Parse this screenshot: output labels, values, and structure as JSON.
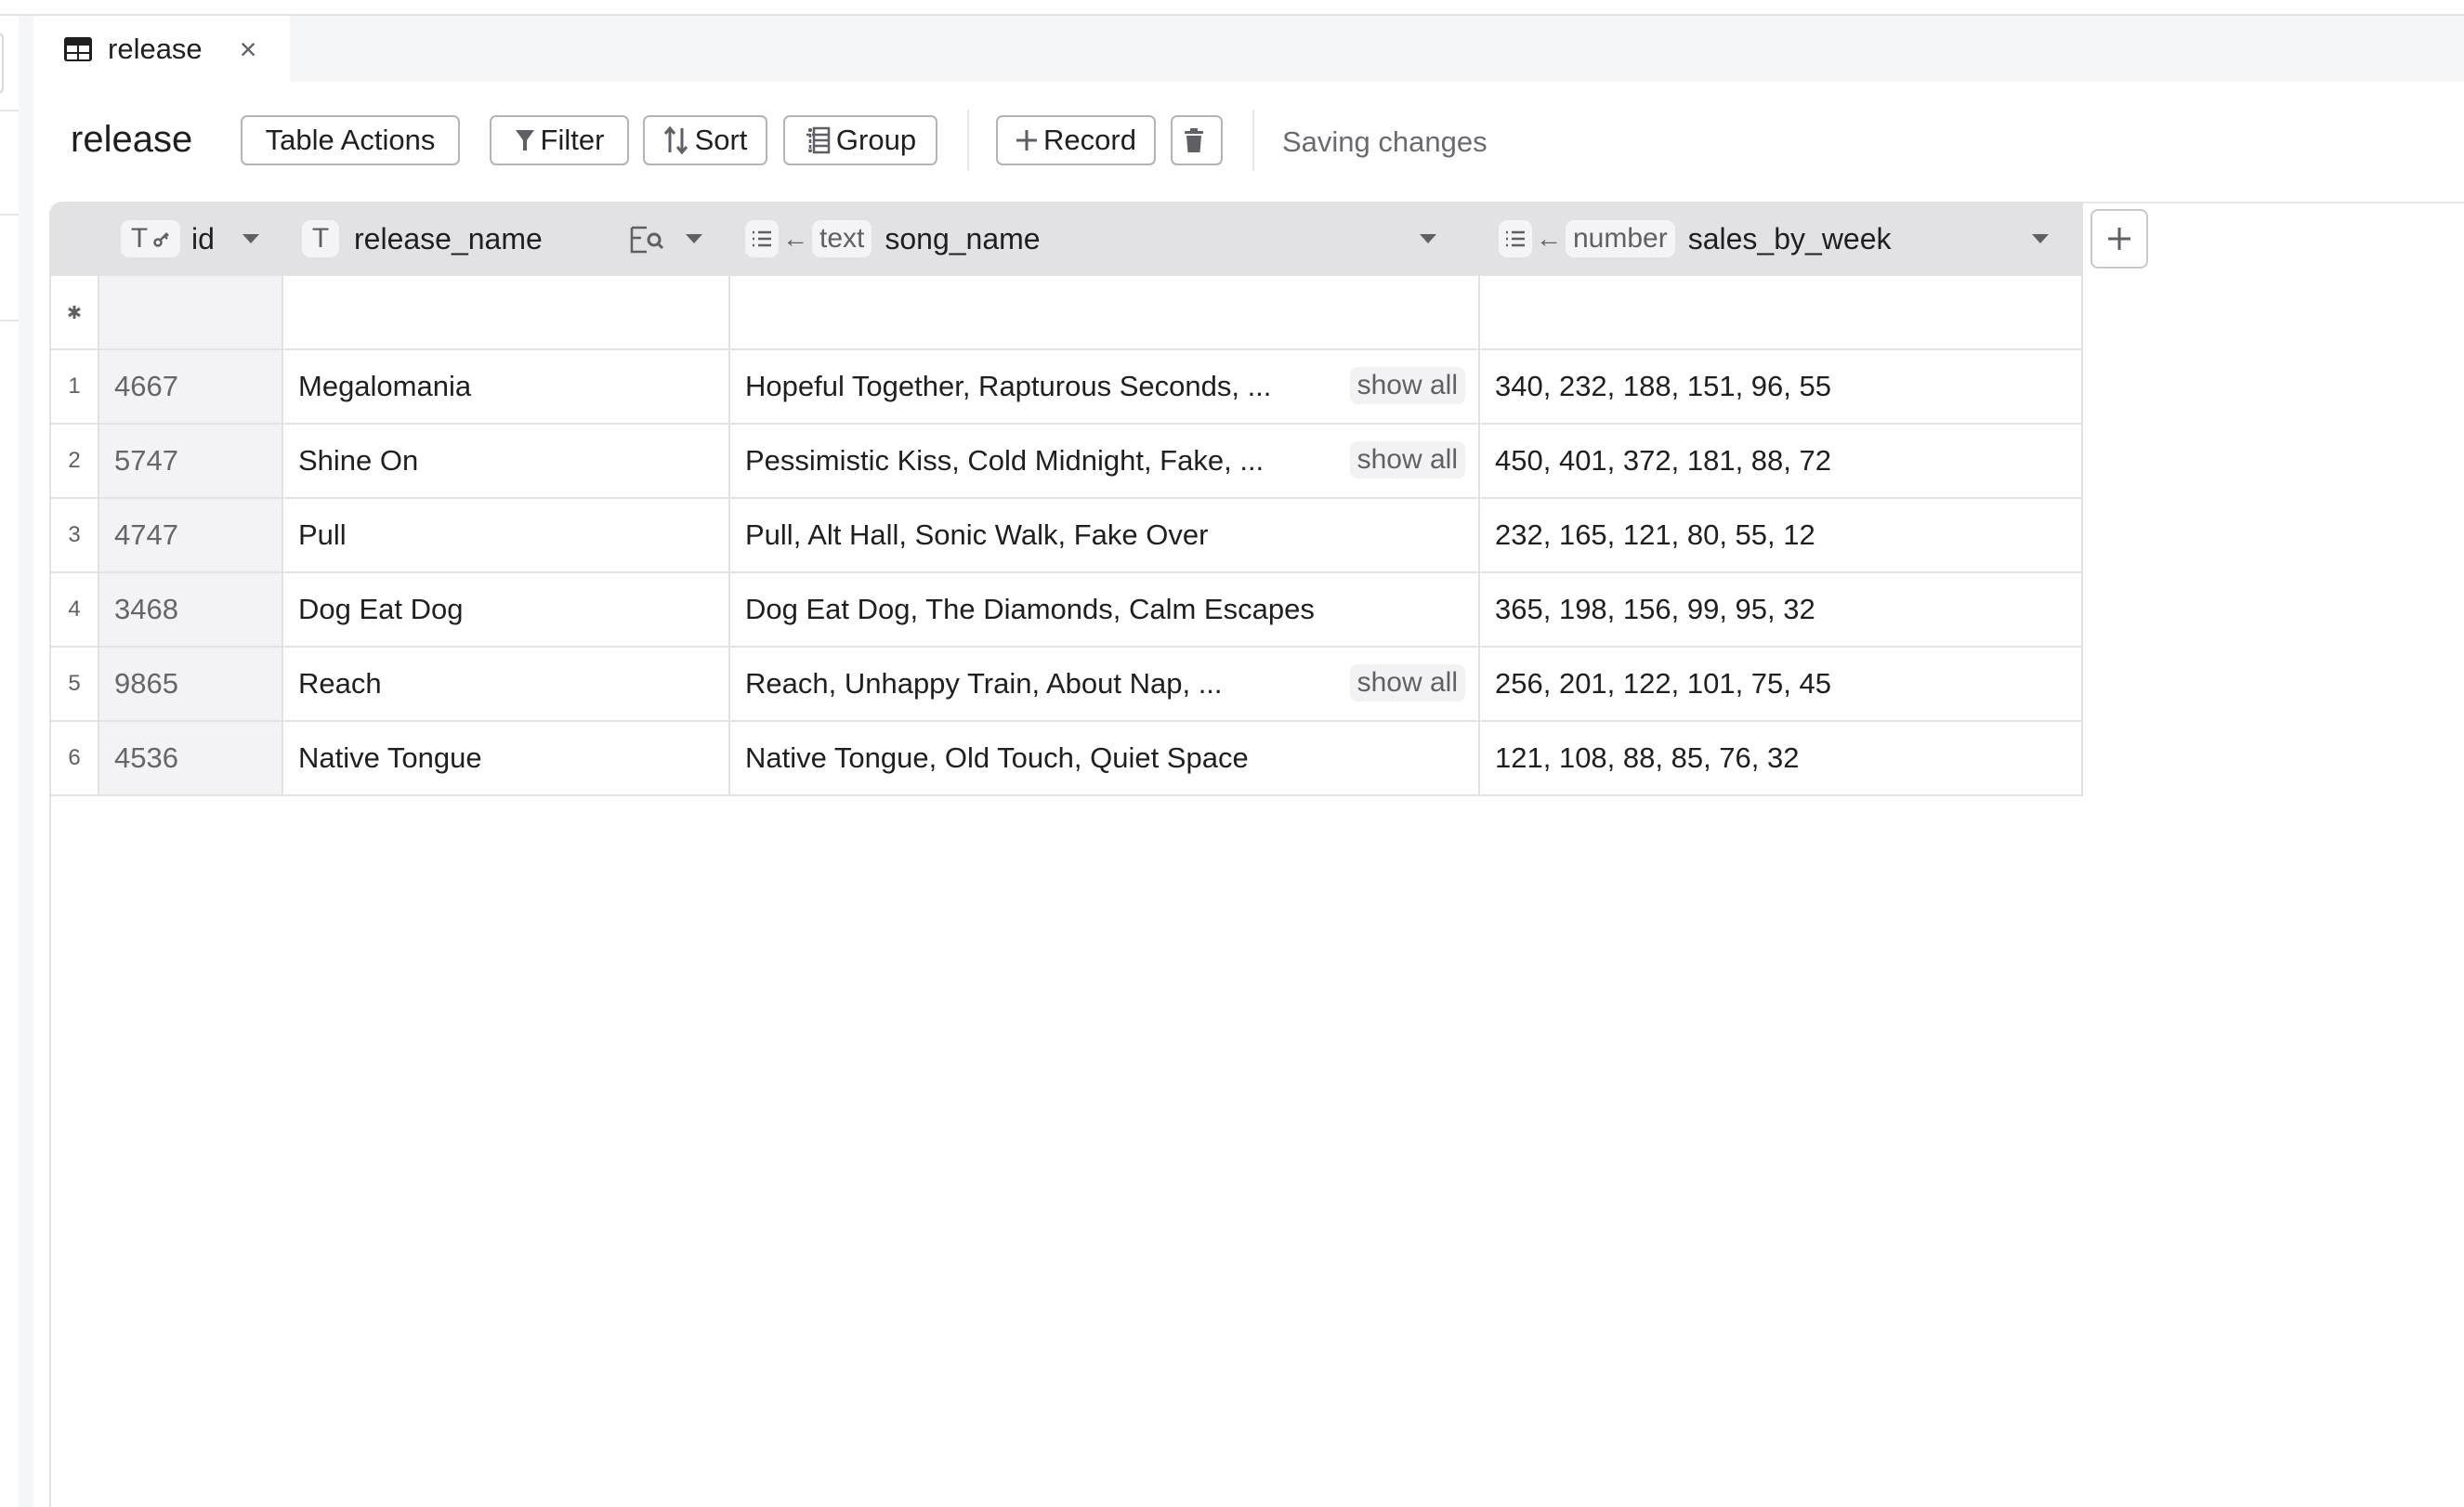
{
  "tab": {
    "label": "release",
    "icon": "table-icon",
    "close_icon": "close-icon",
    "close_glyph": "×"
  },
  "toolbar": {
    "title": "release",
    "table_actions": "Table Actions",
    "filter": "Filter",
    "sort": "Sort",
    "group": "Group",
    "record": "Record",
    "delete_icon": "trash-icon",
    "status": "Saving changes"
  },
  "columns": [
    {
      "name": "id",
      "type_chip": "T",
      "extra_icon": "key-icon"
    },
    {
      "name": "release_name",
      "type_chip": "T",
      "extra_icon": "lookup-search-icon"
    },
    {
      "name": "song_name",
      "type_chip": "list-icon",
      "link_arrow": "←",
      "ref_type": "text"
    },
    {
      "name": "sales_by_week",
      "type_chip": "list-icon",
      "link_arrow": "←",
      "ref_type": "number"
    }
  ],
  "new_row_marker": "*",
  "show_all_label": "show all",
  "rows": [
    {
      "num": "1",
      "id": "4667",
      "release_name": "Megalomania",
      "song_name": "Hopeful Together, Rapturous Seconds, ...",
      "show_all": true,
      "sales_by_week": "340, 232, 188, 151, 96, 55"
    },
    {
      "num": "2",
      "id": "5747",
      "release_name": "Shine On",
      "song_name": "Pessimistic Kiss, Cold Midnight, Fake, ...",
      "show_all": true,
      "sales_by_week": "450, 401, 372, 181, 88, 72"
    },
    {
      "num": "3",
      "id": "4747",
      "release_name": "Pull",
      "song_name": "Pull, Alt Hall, Sonic Walk, Fake Over",
      "show_all": false,
      "sales_by_week": "232, 165, 121, 80, 55, 12"
    },
    {
      "num": "4",
      "id": "3468",
      "release_name": "Dog Eat Dog",
      "song_name": "Dog Eat Dog, The Diamonds, Calm Escapes",
      "show_all": false,
      "sales_by_week": "365, 198, 156, 99, 95, 32"
    },
    {
      "num": "5",
      "id": "9865",
      "release_name": "Reach",
      "song_name": "Reach, Unhappy Train, About Nap, ...",
      "show_all": true,
      "sales_by_week": "256, 201, 122, 101, 75, 45"
    },
    {
      "num": "6",
      "id": "4536",
      "release_name": "Native Tongue",
      "song_name": "Native Tongue, Old Touch, Quiet Space",
      "show_all": false,
      "sales_by_week": "121, 108, 88, 85, 76, 32"
    }
  ],
  "add_column_icon": "plus-icon",
  "colors": {
    "header_bg": "#e2e2e4",
    "id_col_bg": "#f3f3f5",
    "tabbar_bg": "#f5f6f8",
    "border": "#e2e2e4",
    "icon": "#5f5f66"
  }
}
